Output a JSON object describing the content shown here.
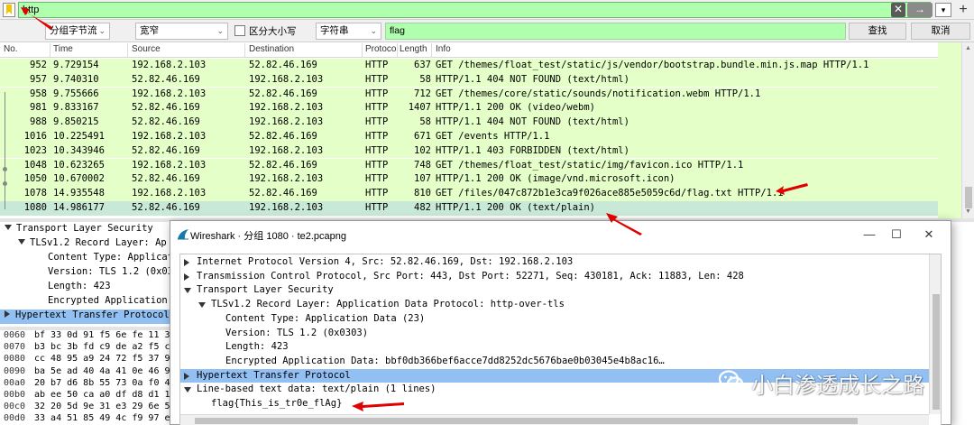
{
  "filter": {
    "value": "http",
    "clear_icon": "✕",
    "apply_icon": "→"
  },
  "search": {
    "pane_select": "分组字节流",
    "width_select": "宽窄",
    "case_label": "区分大小写",
    "type_select": "字符串",
    "query": "flag",
    "find_button": "查找",
    "cancel_button": "取消"
  },
  "packet_list": {
    "columns": [
      "No.",
      "Time",
      "Source",
      "Destination",
      "Protocol",
      "Length",
      "Info"
    ],
    "rows": [
      {
        "no": "952",
        "time": "9.729154",
        "src": "192.168.2.103",
        "dst": "52.82.46.169",
        "proto": "HTTP",
        "len": "637",
        "info": "GET /themes/float_test/static/js/vendor/bootstrap.bundle.min.js.map HTTP/1.1"
      },
      {
        "no": "957",
        "time": "9.740310",
        "src": "52.82.46.169",
        "dst": "192.168.2.103",
        "proto": "HTTP",
        "len": "58",
        "info": "HTTP/1.1 404 NOT FOUND  (text/html)"
      },
      {
        "no": "958",
        "time": "9.755666",
        "src": "192.168.2.103",
        "dst": "52.82.46.169",
        "proto": "HTTP",
        "len": "712",
        "info": "GET /themes/core/static/sounds/notification.webm HTTP/1.1"
      },
      {
        "no": "981",
        "time": "9.833167",
        "src": "52.82.46.169",
        "dst": "192.168.2.103",
        "proto": "HTTP",
        "len": "1407",
        "info": "HTTP/1.1 200 OK  (video/webm)"
      },
      {
        "no": "988",
        "time": "9.850215",
        "src": "52.82.46.169",
        "dst": "192.168.2.103",
        "proto": "HTTP",
        "len": "58",
        "info": "HTTP/1.1 404 NOT FOUND  (text/html)"
      },
      {
        "no": "1016",
        "time": "10.225491",
        "src": "192.168.2.103",
        "dst": "52.82.46.169",
        "proto": "HTTP",
        "len": "671",
        "info": "GET /events HTTP/1.1"
      },
      {
        "no": "1023",
        "time": "10.343946",
        "src": "52.82.46.169",
        "dst": "192.168.2.103",
        "proto": "HTTP",
        "len": "102",
        "info": "HTTP/1.1 403 FORBIDDEN  (text/html)"
      },
      {
        "no": "1048",
        "time": "10.623265",
        "src": "192.168.2.103",
        "dst": "52.82.46.169",
        "proto": "HTTP",
        "len": "748",
        "info": "GET /themes/float_test/static/img/favicon.ico HTTP/1.1"
      },
      {
        "no": "1050",
        "time": "10.670002",
        "src": "52.82.46.169",
        "dst": "192.168.2.103",
        "proto": "HTTP",
        "len": "107",
        "info": "HTTP/1.1 200 OK  (image/vnd.microsoft.icon)"
      },
      {
        "no": "1078",
        "time": "14.935548",
        "src": "192.168.2.103",
        "dst": "52.82.46.169",
        "proto": "HTTP",
        "len": "810",
        "info": "GET /files/047c872b1e3ca9f026ace885e5059c6d/flag.txt HTTP/1.1"
      },
      {
        "no": "1080",
        "time": "14.986177",
        "src": "52.82.46.169",
        "dst": "192.168.2.103",
        "proto": "HTTP",
        "len": "482",
        "info": "HTTP/1.1 200 OK  (text/plain)"
      }
    ]
  },
  "details_pane": {
    "rows": [
      "Transport Layer Security",
      "TLSv1.2 Record Layer: Ap",
      "Content Type: Applicat",
      "Version: TLS 1.2 (0x03",
      "Length: 423",
      "Encrypted Application",
      "Hypertext Transfer Protocol",
      "Line-based text data: tex",
      "flag{This_is_tr0e_flAg}"
    ]
  },
  "bytes_pane": {
    "rows": [
      {
        "offset": "0060",
        "hex": "bf 33 0d 91 f5 6e fe 11  3"
      },
      {
        "offset": "0070",
        "hex": "b3 bc 3b fd c9 de a2 f5  c"
      },
      {
        "offset": "0080",
        "hex": "cc 48 95 a9 24 72 f5 37  9"
      },
      {
        "offset": "0090",
        "hex": "ba 5e ad 40 4a 41 0e 46  9"
      },
      {
        "offset": "00a0",
        "hex": "20 b7 d6 8b 55 73 0a f0  4"
      },
      {
        "offset": "00b0",
        "hex": "ab ee 50 ca a0 df d8 d1  1"
      },
      {
        "offset": "00c0",
        "hex": "32 20 5d 9e 31 e3 29 6e  5"
      },
      {
        "offset": "00d0",
        "hex": "33 a4 51 85 49 4c f9 97  e"
      }
    ]
  },
  "popup": {
    "title": "Wireshark · 分组 1080 · te2.pcapng",
    "minimize": "—",
    "maximize": "☐",
    "close": "✕",
    "rows": [
      {
        "text": "Internet Protocol Version 4, Src: 52.82.46.169, Dst: 192.168.2.103",
        "indent": 0,
        "tri": "right",
        "hl": false
      },
      {
        "text": "Transmission Control Protocol, Src Port: 443, Dst Port: 52271, Seq: 430181, Ack: 11883, Len: 428",
        "indent": 0,
        "tri": "right",
        "hl": false
      },
      {
        "text": "Transport Layer Security",
        "indent": 0,
        "tri": "down",
        "hl": false
      },
      {
        "text": "TLSv1.2 Record Layer: Application Data Protocol: http-over-tls",
        "indent": 1,
        "tri": "down",
        "hl": false
      },
      {
        "text": "Content Type: Application Data (23)",
        "indent": 2,
        "tri": "none",
        "hl": false
      },
      {
        "text": "Version: TLS 1.2 (0x0303)",
        "indent": 2,
        "tri": "none",
        "hl": false
      },
      {
        "text": "Length: 423",
        "indent": 2,
        "tri": "none",
        "hl": false
      },
      {
        "text": "Encrypted Application Data: bbf0db366bef6acce7dd8252dc5676bae0b03045e4b8ac16…",
        "indent": 2,
        "tri": "none",
        "hl": false
      },
      {
        "text": "Hypertext Transfer Protocol",
        "indent": 0,
        "tri": "right",
        "hl": true
      },
      {
        "text": "Line-based text data: text/plain (1 lines)",
        "indent": 0,
        "tri": "down",
        "hl": false
      },
      {
        "text": "flag{This_is_tr0e_flAg}",
        "indent": 1,
        "tri": "none",
        "hl": false
      }
    ]
  },
  "watermark": {
    "text": "小白渗透成长之路"
  },
  "colors": {
    "filter_valid": "#afffaf",
    "http_row": "#e4ffc7",
    "selected_row": "#c8e8d8",
    "highlight_row": "#92c0f3",
    "annotation_red": "#e00000"
  }
}
